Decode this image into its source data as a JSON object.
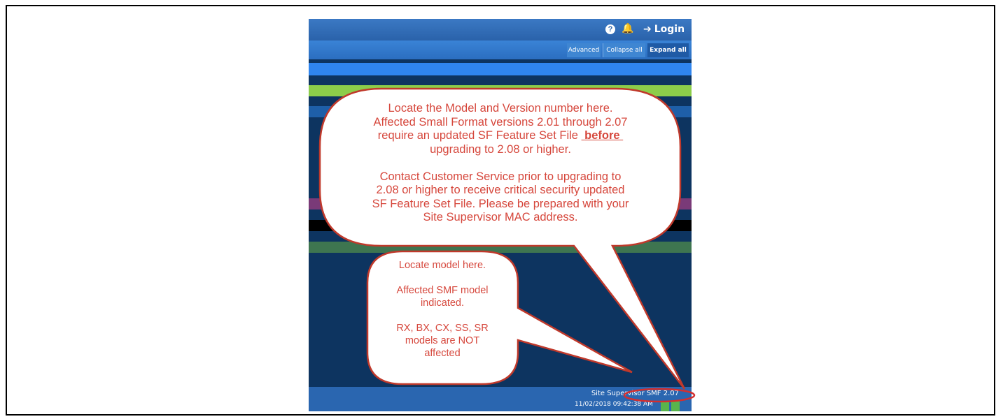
{
  "header": {
    "help_icon": "question-circle-icon",
    "bell_icon": "bell-icon",
    "login_label": "Login"
  },
  "toolbar": {
    "advanced_label": "Advanced",
    "collapse_label": "Collapse all",
    "expand_label": "Expand all"
  },
  "status": {
    "model_version": "Site Supervisor SMF 2.07",
    "timestamp": "11/02/2018 09:42:38 AM"
  },
  "callouts": {
    "main": {
      "line1": "Locate the Model and Version number here.",
      "line2": "Affected Small Format versions 2.01 through 2.07",
      "line3_prefix": "require an updated SF Feature Set File",
      "line3_emph": "before",
      "line4": "upgrading to 2.08 or higher.",
      "line5": "Contact  Customer Service prior to upgrading to",
      "line6": "2.08 or higher to receive critical security updated",
      "line7": "SF Feature Set File.  Please be prepared with your",
      "line8": "Site Supervisor MAC address."
    },
    "model": {
      "line1": "Locate model here.",
      "line2": "Affected SMF model",
      "line3": "indicated.",
      "line4": "RX, BX, CX, SS, SR",
      "line5": "models are NOT",
      "line6": "affected"
    }
  },
  "colors": {
    "callout_text": "#d6473c",
    "callout_border": "#c0392b",
    "highlight_ellipse": "#d32f2f",
    "header_blue": "#2a62aa",
    "app_background": "#0d3460"
  }
}
